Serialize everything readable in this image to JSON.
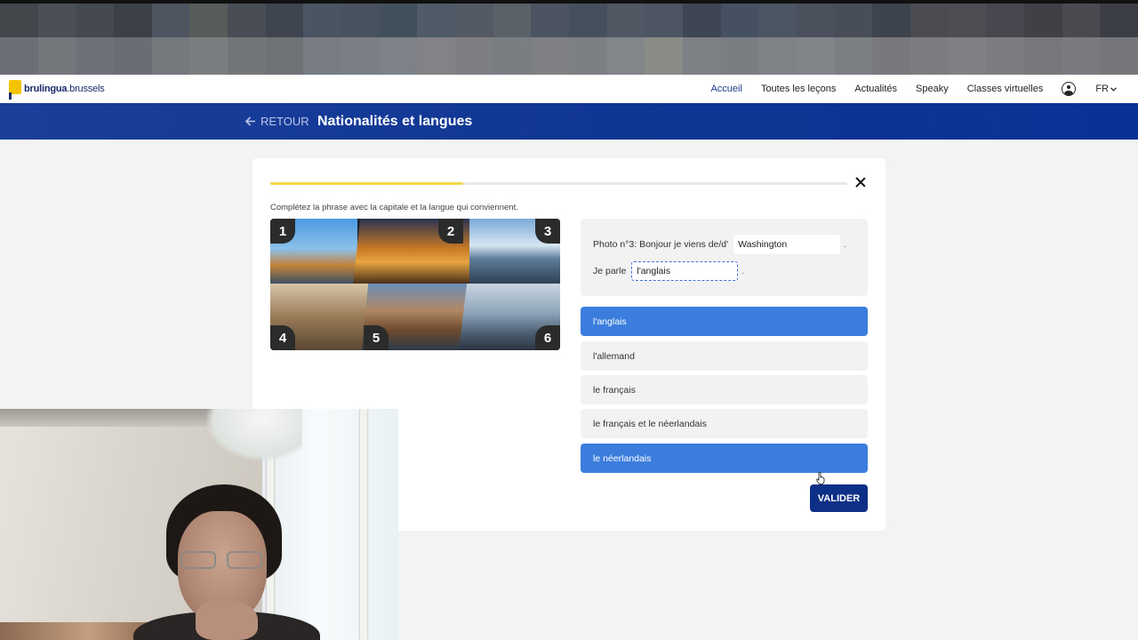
{
  "blur": {
    "row1": [
      "#43464b",
      "#4d4f56",
      "#454a52",
      "#3c4148",
      "#4f5560",
      "#575b59",
      "#494e56",
      "#3f454e",
      "#4a5463",
      "#48525f",
      "#42505d",
      "#4f5b66",
      "#545a64",
      "#5a6168",
      "#4c5461",
      "#46505c",
      "#515864",
      "#4d5562",
      "#3e4653",
      "#455060",
      "#4c5563",
      "#4a505c",
      "#474e58",
      "#3e444e",
      "#4b4c52",
      "#4e4d54",
      "#47484f",
      "#3f4147",
      "#4a4a50",
      "#3b3e44"
    ],
    "row2": [
      "#6c6f75",
      "#74777b",
      "#6e7278",
      "#6a6e74",
      "#75797e",
      "#7a7e80",
      "#727679",
      "#6f7378",
      "#787d84",
      "#7a7f86",
      "#7c8288",
      "#838387",
      "#7d7f84",
      "#7a7d82",
      "#7e8084",
      "#7c7f83",
      "#828589",
      "#888b86",
      "#7d8186",
      "#7a7e83",
      "#7e8186",
      "#818488",
      "#7b7f84",
      "#77797e",
      "#7a7c80",
      "#7f8084",
      "#7b7d80",
      "#76787c",
      "#797b80",
      "#75777b"
    ]
  },
  "nav": {
    "logo_name": "brulingua",
    "logo_domain": ".brussels",
    "links": [
      "Accueil",
      "Toutes les leçons",
      "Actualités",
      "Speaky",
      "Classes virtuelles"
    ],
    "language": "FR"
  },
  "header": {
    "back_label": "RETOUR",
    "title": "Nationalités et langues"
  },
  "exercise": {
    "progress": 0.335,
    "instruction": "Complétez la phrase avec la capitale et la langue qui conviennent.",
    "tiles": [
      "1",
      "2",
      "3",
      "4",
      "5",
      "6"
    ],
    "sentence": {
      "prefix1": "Photo n°3: Bonjour je viens de/d'",
      "answer1": "Washington",
      "suffix1": ".",
      "prefix2": "Je parle",
      "answer2": "l'anglais",
      "suffix2": "."
    },
    "options": [
      {
        "label": "l'anglais",
        "selected": true
      },
      {
        "label": "l'allemand",
        "selected": false
      },
      {
        "label": "le français",
        "selected": false
      },
      {
        "label": "le français et le néerlandais",
        "selected": false
      },
      {
        "label": "le néerlandais",
        "selected": true
      }
    ],
    "validate_label": "VALIDER"
  },
  "colors": {
    "brand_blue": "#0d2f86",
    "selected_option": "#3b7ddd",
    "progress": "#f2d84a",
    "logo_yellow": "#f5c400"
  }
}
